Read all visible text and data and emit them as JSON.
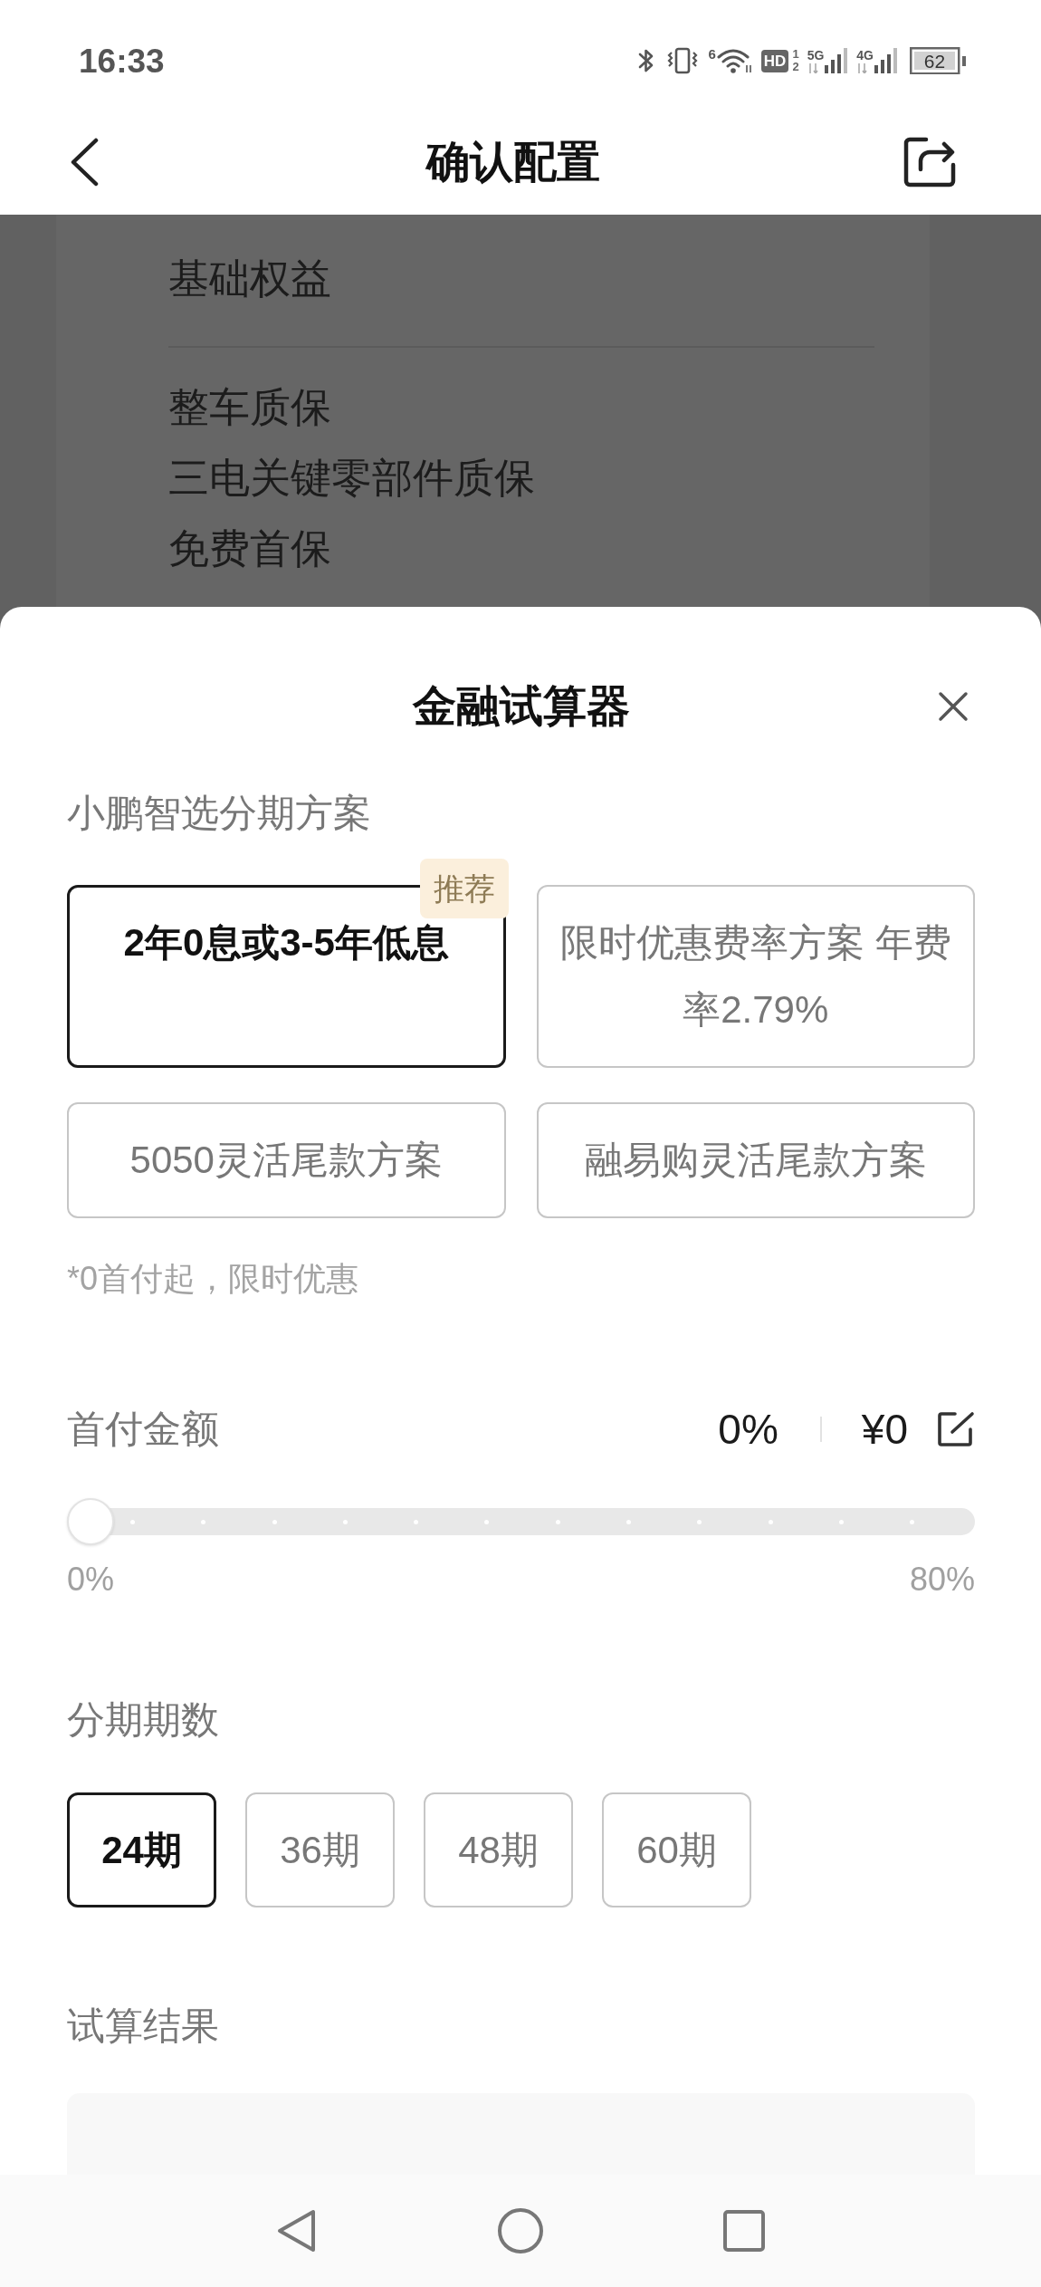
{
  "status_bar": {
    "time": "16:33",
    "wifi_label": "6",
    "hd_label": "HD",
    "sim_slots": [
      "1",
      "2"
    ],
    "signals": [
      {
        "network": "5G"
      },
      {
        "network": "4G"
      }
    ],
    "battery": "62"
  },
  "header": {
    "title": "确认配置"
  },
  "background_page": {
    "section_title": "基础权益",
    "items": [
      "整车质保",
      "三电关键零部件质保",
      "免费首保"
    ]
  },
  "sheet": {
    "title": "金融试算器",
    "plan_label": "小鹏智选分期方案",
    "plans": [
      {
        "label": "2年0息或3-5年低息",
        "selected": true,
        "badge": "推荐"
      },
      {
        "label": "限时优惠费率方案 年费率2.79%",
        "selected": false
      },
      {
        "label": "5050灵活尾款方案",
        "selected": false
      },
      {
        "label": "融易购灵活尾款方案",
        "selected": false
      }
    ],
    "plan_note": "*0首付起，限时优惠",
    "down_payment": {
      "label": "首付金额",
      "percent": "0%",
      "amount": "¥0",
      "level": 0,
      "min_label": "0%",
      "max_label": "80%"
    },
    "term_label": "分期期数",
    "terms": [
      {
        "label": "24期",
        "selected": true
      },
      {
        "label": "36期",
        "selected": false
      },
      {
        "label": "48期",
        "selected": false
      },
      {
        "label": "60期",
        "selected": false
      }
    ],
    "result_label": "试算结果"
  }
}
